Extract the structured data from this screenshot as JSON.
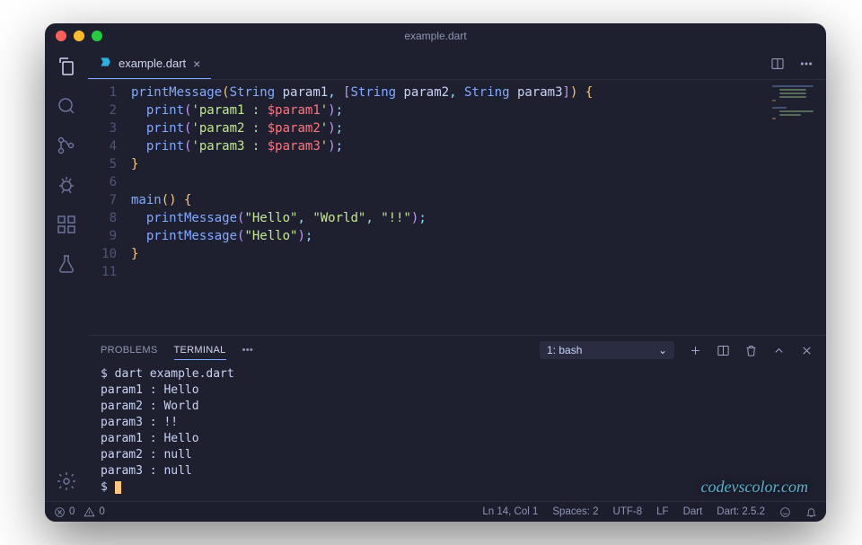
{
  "window": {
    "title": "example.dart"
  },
  "tab": {
    "filename": "example.dart"
  },
  "code": {
    "lines": [
      {
        "n": 1,
        "segs": [
          {
            "t": "printMessage",
            "c": "fn"
          },
          {
            "t": "(",
            "c": "bracket1"
          },
          {
            "t": "String",
            "c": "type"
          },
          {
            "t": " "
          },
          {
            "t": "param1",
            "c": "param"
          },
          {
            "t": ", ",
            "c": "punc"
          },
          {
            "t": "[",
            "c": "bracket2"
          },
          {
            "t": "String",
            "c": "type"
          },
          {
            "t": " "
          },
          {
            "t": "param2",
            "c": "param"
          },
          {
            "t": ", ",
            "c": "punc"
          },
          {
            "t": "String",
            "c": "type"
          },
          {
            "t": " "
          },
          {
            "t": "param3",
            "c": "param"
          },
          {
            "t": "]",
            "c": "bracket2"
          },
          {
            "t": ")",
            "c": "bracket1"
          },
          {
            "t": " "
          },
          {
            "t": "{",
            "c": "bracket1"
          }
        ]
      },
      {
        "n": 2,
        "segs": [
          {
            "t": "  "
          },
          {
            "t": "print",
            "c": "fn"
          },
          {
            "t": "(",
            "c": "bracket2"
          },
          {
            "t": "'param1 : ",
            "c": "str"
          },
          {
            "t": "$param1",
            "c": "interp"
          },
          {
            "t": "'",
            "c": "str"
          },
          {
            "t": ")",
            "c": "bracket2"
          },
          {
            "t": ";",
            "c": "punc"
          }
        ]
      },
      {
        "n": 3,
        "segs": [
          {
            "t": "  "
          },
          {
            "t": "print",
            "c": "fn"
          },
          {
            "t": "(",
            "c": "bracket2"
          },
          {
            "t": "'param2 : ",
            "c": "str"
          },
          {
            "t": "$param2",
            "c": "interp"
          },
          {
            "t": "'",
            "c": "str"
          },
          {
            "t": ")",
            "c": "bracket2"
          },
          {
            "t": ";",
            "c": "punc"
          }
        ]
      },
      {
        "n": 4,
        "segs": [
          {
            "t": "  "
          },
          {
            "t": "print",
            "c": "fn"
          },
          {
            "t": "(",
            "c": "bracket2"
          },
          {
            "t": "'param3 : ",
            "c": "str"
          },
          {
            "t": "$param3",
            "c": "interp"
          },
          {
            "t": "'",
            "c": "str"
          },
          {
            "t": ")",
            "c": "bracket2"
          },
          {
            "t": ";",
            "c": "punc"
          }
        ]
      },
      {
        "n": 5,
        "segs": [
          {
            "t": "}",
            "c": "bracket1"
          }
        ]
      },
      {
        "n": 6,
        "segs": []
      },
      {
        "n": 7,
        "segs": [
          {
            "t": "main",
            "c": "fn"
          },
          {
            "t": "(",
            "c": "bracket1"
          },
          {
            "t": ")",
            "c": "bracket1"
          },
          {
            "t": " "
          },
          {
            "t": "{",
            "c": "bracket1"
          }
        ]
      },
      {
        "n": 8,
        "segs": [
          {
            "t": "  "
          },
          {
            "t": "printMessage",
            "c": "fn"
          },
          {
            "t": "(",
            "c": "bracket2"
          },
          {
            "t": "\"Hello\"",
            "c": "str"
          },
          {
            "t": ", ",
            "c": "punc"
          },
          {
            "t": "\"World\"",
            "c": "str"
          },
          {
            "t": ", ",
            "c": "punc"
          },
          {
            "t": "\"!!\"",
            "c": "str"
          },
          {
            "t": ")",
            "c": "bracket2"
          },
          {
            "t": ";",
            "c": "punc"
          }
        ]
      },
      {
        "n": 9,
        "segs": [
          {
            "t": "  "
          },
          {
            "t": "printMessage",
            "c": "fn"
          },
          {
            "t": "(",
            "c": "bracket2"
          },
          {
            "t": "\"Hello\"",
            "c": "str"
          },
          {
            "t": ")",
            "c": "bracket2"
          },
          {
            "t": ";",
            "c": "punc"
          }
        ]
      },
      {
        "n": 10,
        "segs": [
          {
            "t": "}",
            "c": "bracket1"
          }
        ]
      },
      {
        "n": 11,
        "segs": []
      }
    ]
  },
  "panel": {
    "tabs": {
      "problems": "PROBLEMS",
      "terminal": "TERMINAL"
    },
    "dropdown_label": "1: bash"
  },
  "terminal": {
    "lines": [
      "$ dart example.dart",
      "param1 : Hello",
      "param2 : World",
      "param3 : !!",
      "param1 : Hello",
      "param2 : null",
      "param3 : null",
      "$ "
    ]
  },
  "status": {
    "errors": "0",
    "warnings": "0",
    "position": "Ln 14, Col 1",
    "spaces": "Spaces: 2",
    "encoding": "UTF-8",
    "eol": "LF",
    "lang": "Dart",
    "sdk": "Dart: 2.5.2"
  },
  "watermark": "codevscolor.com"
}
